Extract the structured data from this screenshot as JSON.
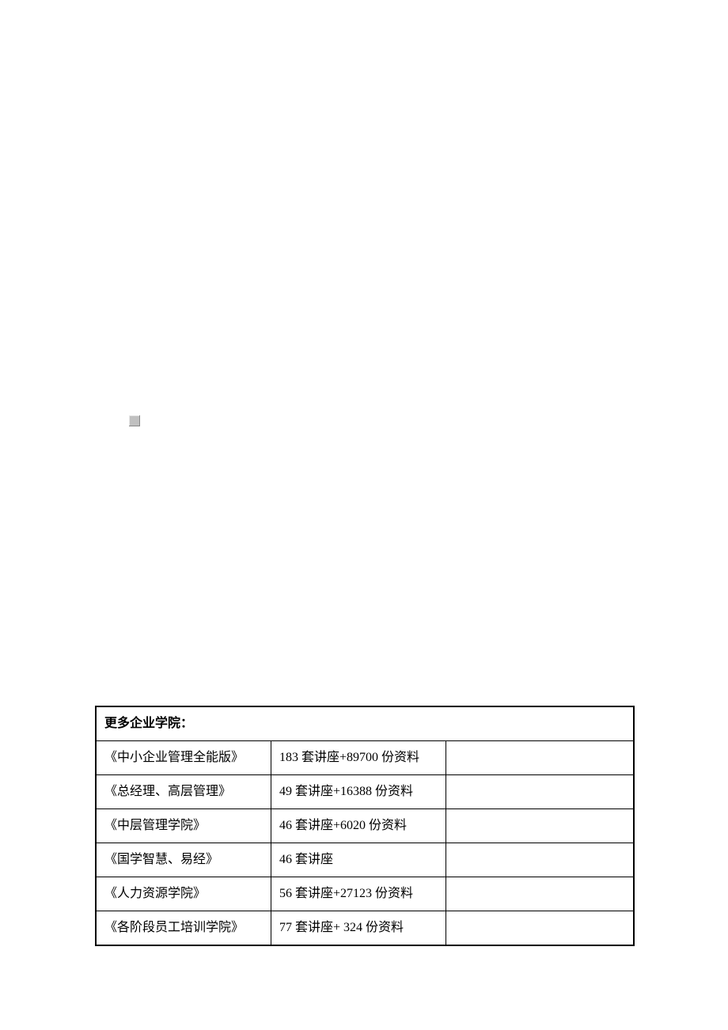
{
  "table": {
    "header": "更多企业学院：",
    "rows": [
      {
        "name": "《中小企业管理全能版》",
        "detail": "183 套讲座+89700 份资料",
        "extra": ""
      },
      {
        "name": "《总经理、高层管理》",
        "detail": "49 套讲座+16388 份资料",
        "extra": ""
      },
      {
        "name": "《中层管理学院》",
        "detail": "46 套讲座+6020 份资料",
        "extra": ""
      },
      {
        "name": "《国学智慧、易经》",
        "detail": "46 套讲座",
        "extra": ""
      },
      {
        "name": "《人力资源学院》",
        "detail": "56 套讲座+27123 份资料",
        "extra": ""
      },
      {
        "name": "《各阶段员工培训学院》",
        "detail": "77 套讲座+ 324 份资料",
        "extra": ""
      }
    ]
  }
}
